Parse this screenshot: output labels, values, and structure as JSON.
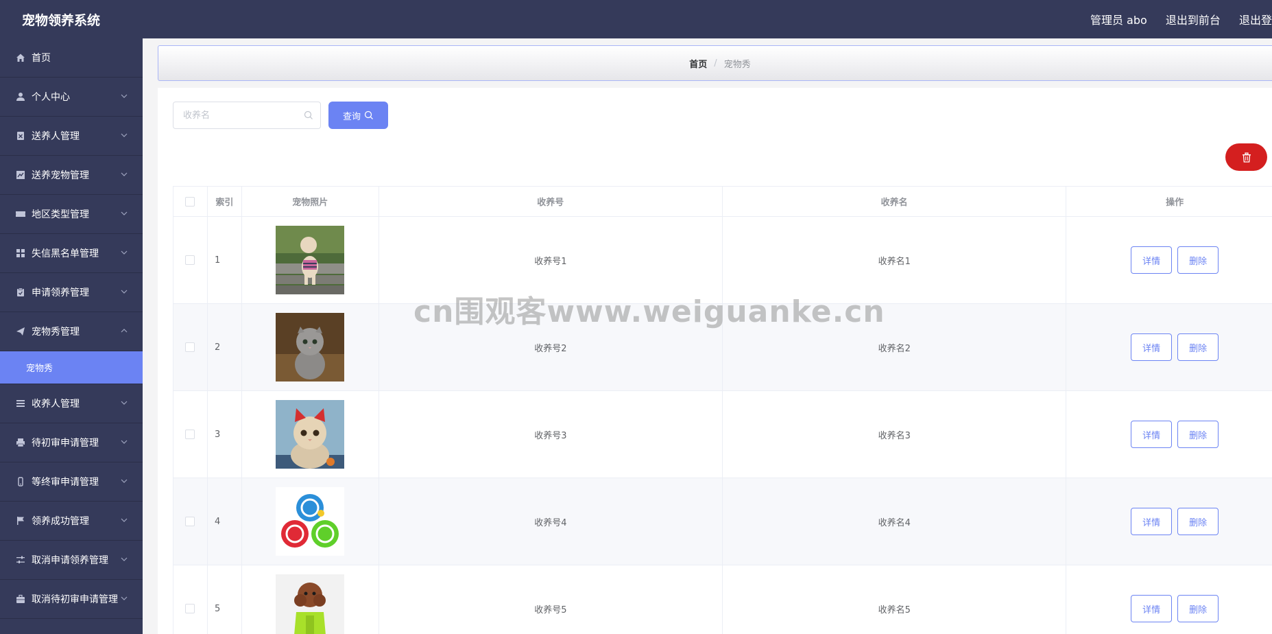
{
  "header": {
    "app_title": "宠物领养系统",
    "admin_label": "管理员 abo",
    "front_link": "退出到前台",
    "logout_link": "退出登"
  },
  "sidebar": {
    "items": [
      {
        "label": "首页",
        "icon": "home-icon"
      },
      {
        "label": "个人中心",
        "icon": "user-icon"
      },
      {
        "label": "送养人管理",
        "icon": "badge-icon"
      },
      {
        "label": "送养宠物管理",
        "icon": "chart-icon"
      },
      {
        "label": "地区类型管理",
        "icon": "ticket-icon"
      },
      {
        "label": "失信黑名单管理",
        "icon": "grid-icon"
      },
      {
        "label": "申请领养管理",
        "icon": "clipboard-icon"
      },
      {
        "label": "宠物秀管理",
        "icon": "send-icon"
      },
      {
        "label": "收养人管理",
        "icon": "list-icon"
      },
      {
        "label": "待初审申请管理",
        "icon": "printer-icon"
      },
      {
        "label": "等终审申请管理",
        "icon": "phone-icon"
      },
      {
        "label": "领养成功管理",
        "icon": "flag-icon"
      },
      {
        "label": "取消申请领养管理",
        "icon": "sliders-icon"
      },
      {
        "label": "取消待初审申请管理",
        "icon": "briefcase-icon"
      }
    ],
    "submenu": {
      "label": "宠物秀"
    }
  },
  "breadcrumb": {
    "home": "首页",
    "separator": "/",
    "current": "宠物秀"
  },
  "search": {
    "placeholder": "收养名",
    "button_label": "查询"
  },
  "table": {
    "headers": {
      "index": "索引",
      "photo": "宠物照片",
      "no": "收养号",
      "name": "收养名",
      "ops": "操作"
    },
    "rows": [
      {
        "index": "1",
        "no": "收养号1",
        "name": "收养名1",
        "detail": "详情",
        "delete": "删除",
        "photo": "white-poodle-on-steps"
      },
      {
        "index": "2",
        "no": "收养号2",
        "name": "收养名2",
        "detail": "详情",
        "delete": "删除",
        "photo": "grey-scottish-fold-kitten"
      },
      {
        "index": "3",
        "no": "收养号3",
        "name": "收养名3",
        "detail": "详情",
        "delete": "删除",
        "photo": "kitten-with-red-cat-ears"
      },
      {
        "index": "4",
        "no": "收养号4",
        "name": "收养名4",
        "detail": "详情",
        "delete": "删除",
        "photo": "three-rubber-ball-toys"
      },
      {
        "index": "5",
        "no": "收养号5",
        "name": "收养名5",
        "detail": "详情",
        "delete": "删除",
        "photo": "brown-poodle-green-shirt"
      }
    ]
  },
  "watermark": "cn围观客www.weiguanke.cn",
  "colors": {
    "sidebar_bg": "#353a5a",
    "accent": "#6b83f3",
    "danger": "#d41f1f",
    "stripe": "#f7f8fb"
  }
}
